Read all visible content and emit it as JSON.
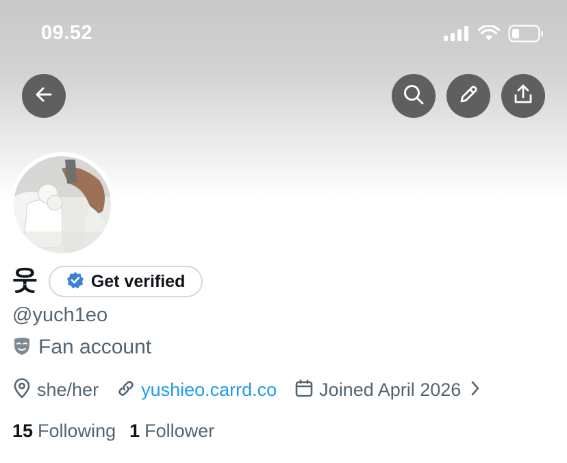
{
  "status_bar": {
    "time": "09.52"
  },
  "nav": {
    "back_icon": "arrow-left-icon",
    "search_icon": "search-icon",
    "edit_icon": "pencil-icon",
    "share_icon": "share-icon"
  },
  "profile": {
    "display_name": "웃",
    "verify_label": "Get verified",
    "handle": "@yuch1eo",
    "bio": "Fan account",
    "pronouns": "she/her",
    "link": "yushieo.carrd.co",
    "joined": "Joined April 2026",
    "following_count": "15",
    "following_label": "Following",
    "followers_count": "1",
    "followers_label": "Follower"
  },
  "colors": {
    "link": "#1d9bf0",
    "muted": "#536471",
    "nav_button": "#5f5f5f",
    "verified_badge": "#3b82d6"
  }
}
